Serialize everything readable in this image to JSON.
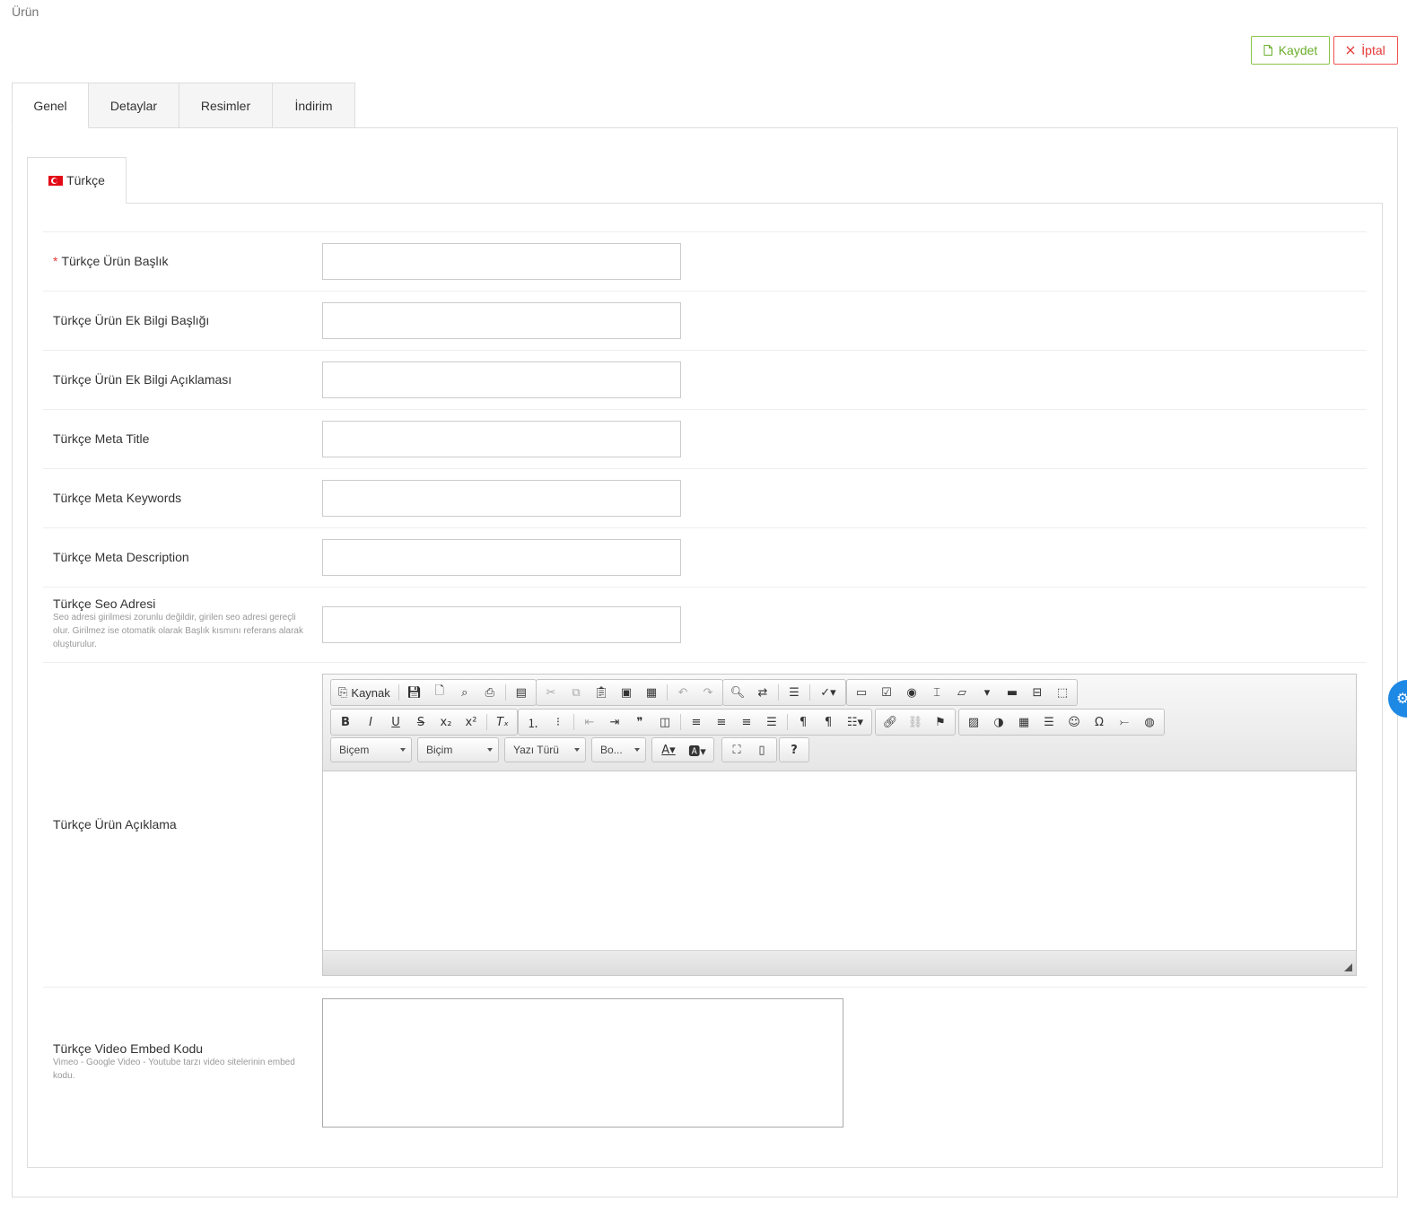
{
  "page": {
    "title": "Ürün"
  },
  "actions": {
    "save_label": "Kaydet",
    "cancel_label": "İptal"
  },
  "tabs": [
    {
      "label": "Genel",
      "active": true
    },
    {
      "label": "Detaylar",
      "active": false
    },
    {
      "label": "Resimler",
      "active": false
    },
    {
      "label": "İndirim",
      "active": false
    }
  ],
  "language_tab": {
    "label": "Türkçe",
    "flag_icon": "turkey-flag-icon"
  },
  "form": {
    "required_mark": "*",
    "fields": [
      {
        "label": "Türkçe Ürün Başlık",
        "value": "",
        "required": true
      },
      {
        "label": "Türkçe Ürün Ek Bilgi Başlığı",
        "value": ""
      },
      {
        "label": "Türkçe Ürün Ek Bilgi Açıklaması",
        "value": ""
      },
      {
        "label": "Türkçe Meta Title",
        "value": ""
      },
      {
        "label": "Türkçe Meta Keywords",
        "value": ""
      },
      {
        "label": "Türkçe Meta Description",
        "value": ""
      },
      {
        "label": "Türkçe Seo Adresi",
        "value": "",
        "hint": "Seo adresi girilmesi zorunlu değildir, girilen seo adresi gereçli olur. Girilmez ise otomatik olarak Başlık kısmını referans alarak oluşturulur."
      }
    ],
    "description": {
      "label": "Türkçe Ürün Açıklama",
      "value": ""
    },
    "video": {
      "label": "Türkçe Video Embed Kodu",
      "hint": "Vimeo - Google Video - Youtube tarzı video sitelerinin embed kodu.",
      "value": ""
    }
  },
  "editor": {
    "source_label": "Kaynak",
    "combos": [
      {
        "label": "Biçem"
      },
      {
        "label": "Biçim"
      },
      {
        "label": "Yazı Türü"
      },
      {
        "label": "Bo..."
      }
    ],
    "help_label": "?"
  },
  "colors": {
    "save": "#6aae2b",
    "cancel": "#e53935",
    "fab": "#1e88e5"
  }
}
